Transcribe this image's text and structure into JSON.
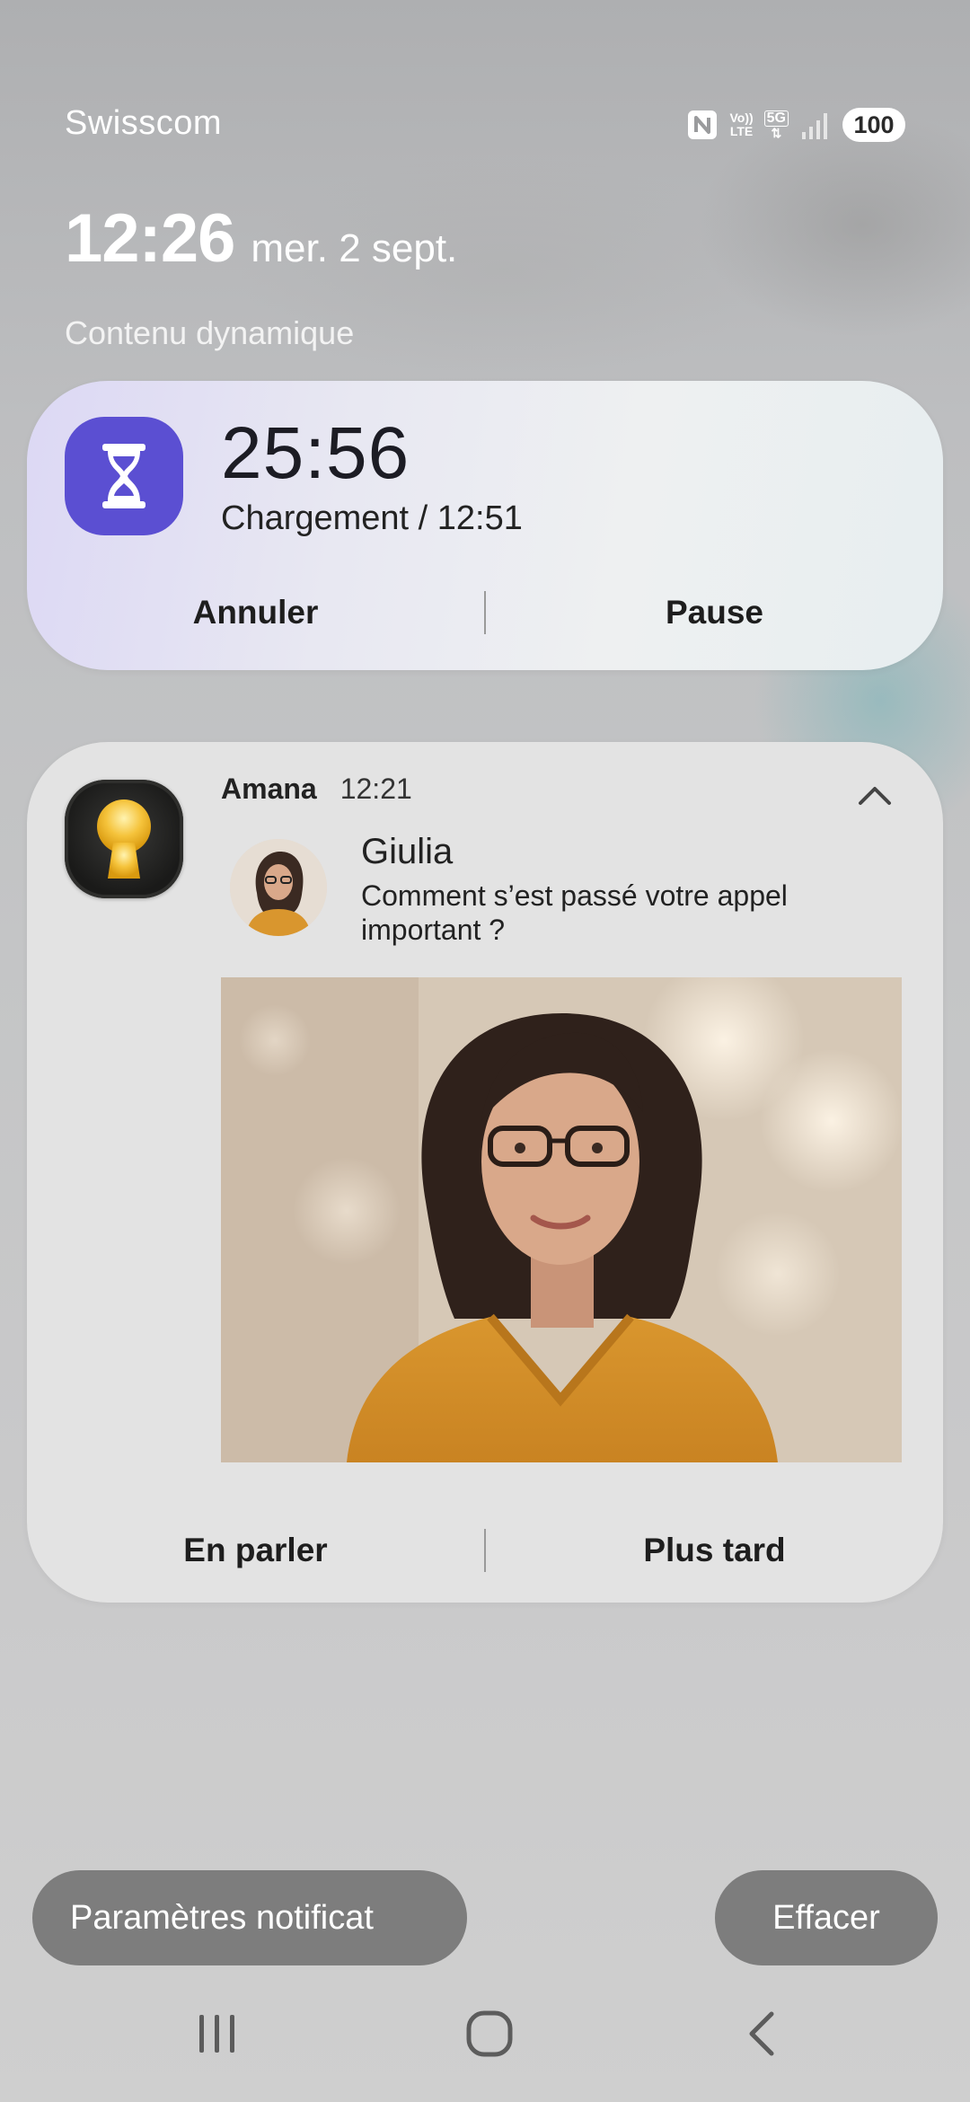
{
  "status_bar": {
    "carrier": "Swisscom",
    "volte_label_top": "Vo))",
    "volte_label_bottom": "LTE",
    "network_label": "5G",
    "battery_level": "100",
    "icons": [
      "nfc-icon",
      "volte-icon",
      "5g-icon",
      "signal-icon"
    ]
  },
  "lockscreen": {
    "time": "12:26",
    "date": "mer. 2 sept.",
    "section_label": "Contenu dynamique"
  },
  "live_activity": {
    "icon": "hourglass-icon",
    "accent_color": "#5b4fd2",
    "timer": "25:56",
    "subtitle": "Chargement / 12:51",
    "actions": {
      "left": "Annuler",
      "right": "Pause"
    }
  },
  "message_notification": {
    "icon": "keyhole-icon",
    "app_name": "Amana",
    "time": "12:21",
    "sender": "Giulia",
    "text": "Comment s’est passé votre appel important ?",
    "actions": {
      "left": "En parler",
      "right": "Plus tard"
    }
  },
  "bottom_actions": {
    "settings": "Paramètres notificat",
    "clear": "Effacer"
  },
  "nav": [
    "recent-apps-icon",
    "home-icon",
    "back-icon"
  ]
}
